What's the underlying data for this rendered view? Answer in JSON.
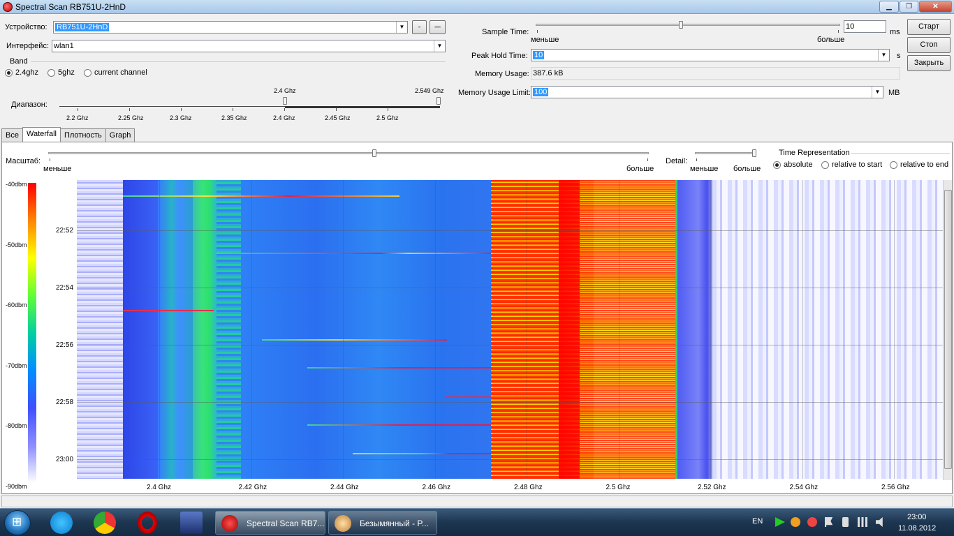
{
  "window": {
    "title": "Spectral Scan RB751U-2HnD"
  },
  "device": {
    "label": "Устройство:",
    "value": "RB751U-2HnD",
    "btn1": "▫",
    "btn2": "▫▫▫"
  },
  "interface": {
    "label": "Интерфейс:",
    "value": "wlan1"
  },
  "band": {
    "group": "Band",
    "opt1": "2.4ghz",
    "opt2": "5ghz",
    "opt3": "current channel",
    "selected": "2.4ghz"
  },
  "range": {
    "label": "Диапазон:",
    "from_label": "2.4 Ghz",
    "to_label": "2.549 Ghz",
    "ticks": [
      "2.2 Ghz",
      "2.25 Ghz",
      "2.3 Ghz",
      "2.35 Ghz",
      "2.4 Ghz",
      "2.45 Ghz",
      "2.5 Ghz"
    ]
  },
  "sample_time": {
    "label": "Sample Time:",
    "less": "меньше",
    "more": "больше",
    "value": "10",
    "unit": "ms"
  },
  "peak_hold": {
    "label": "Peak Hold Time:",
    "value": "10",
    "unit": "s"
  },
  "memory_usage": {
    "label": "Memory Usage:",
    "value": "387.6 kB"
  },
  "memory_limit": {
    "label": "Memory Usage Limit:",
    "value": "100",
    "unit": "MB"
  },
  "buttons": {
    "start": "Старт",
    "stop": "Стоп",
    "close": "Закрыть"
  },
  "tabs": [
    "Все",
    "Waterfall",
    "Плотность",
    "Graph"
  ],
  "active_tab": "Waterfall",
  "scale": {
    "label": "Масштаб:",
    "less": "меньше",
    "more": "больше"
  },
  "detail": {
    "label": "Detail:",
    "less": "меньше",
    "more": "больше"
  },
  "time_rep": {
    "group": "Time Representation",
    "opt1": "absolute",
    "opt2": "relative to start",
    "opt3": "relative to end",
    "selected": "absolute"
  },
  "legend": [
    "-40dbm",
    "-50dbm",
    "-60dbm",
    "-70dbm",
    "-80dbm",
    "-90dbm"
  ],
  "times": [
    "22:52",
    "22:54",
    "22:56",
    "22:58",
    "23:00"
  ],
  "freqs": [
    "2.4 Ghz",
    "2.42 Ghz",
    "2.44 Ghz",
    "2.46 Ghz",
    "2.48 Ghz",
    "2.5 Ghz",
    "2.52 Ghz",
    "2.54 Ghz",
    "2.56 Ghz"
  ],
  "taskbar": {
    "task1": "Spectral Scan RB7...",
    "task2": "Безымянный - P...",
    "lang": "EN",
    "time": "23:00",
    "date": "11.08.2012"
  }
}
